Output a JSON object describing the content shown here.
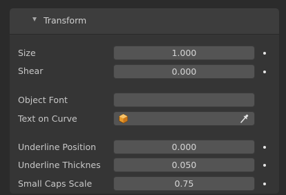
{
  "panel": {
    "title": "Transform",
    "collapse_icon": "triangle-down-icon"
  },
  "rows": {
    "size": {
      "label": "Size",
      "value": "1.000"
    },
    "shear": {
      "label": "Shear",
      "value": "0.000"
    },
    "object_font": {
      "label": "Object Font",
      "value": ""
    },
    "text_on_curve": {
      "label": "Text on Curve",
      "icon": "object-cube-icon",
      "eyedropper_icon": "eyedropper-icon"
    },
    "underline_position": {
      "label": "Underline Position",
      "value": "0.000"
    },
    "underline_thickness": {
      "label": "Underline Thicknes",
      "value": "0.050"
    },
    "small_caps_scale": {
      "label": "Small Caps Scale",
      "value": "0.75"
    }
  },
  "colors": {
    "background": "#2b2b2b",
    "panel": "#353535",
    "header": "#3d3d3d",
    "field": "#545454",
    "text": "#c8c8c8",
    "icon_orange": "#e89a2c"
  }
}
